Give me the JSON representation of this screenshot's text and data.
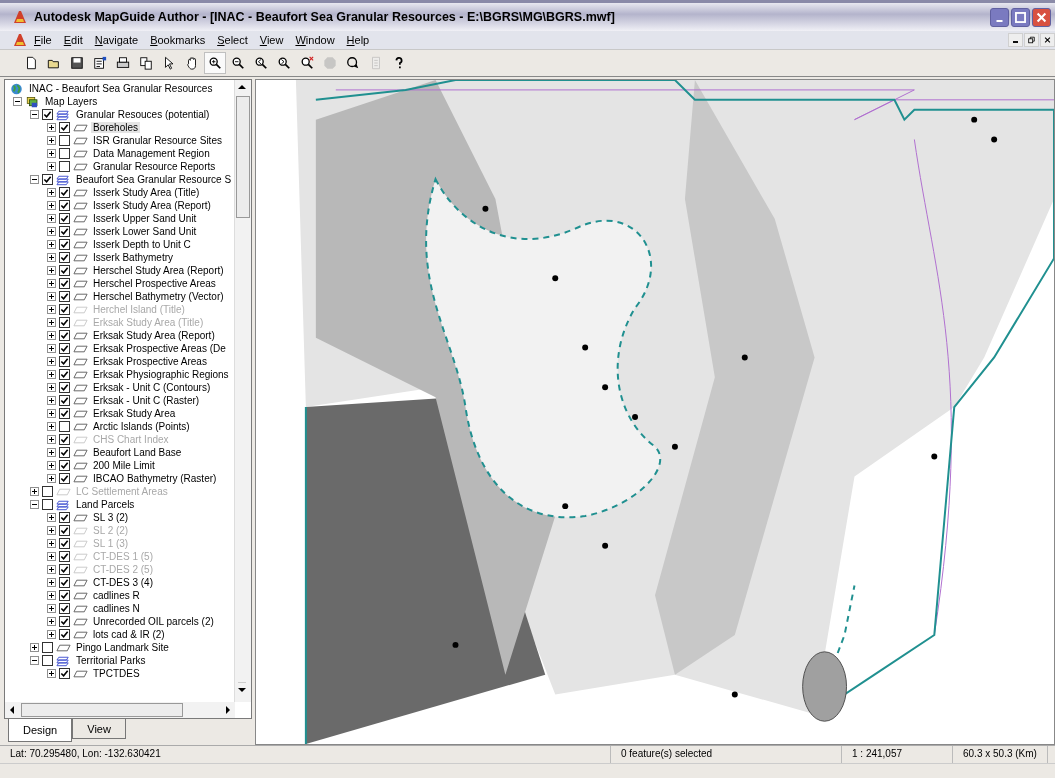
{
  "window": {
    "title": "Autodesk MapGuide Author - [INAC - Beaufort Sea Granular Resources - E:\\BGRS\\MG\\BGRS.mwf]"
  },
  "menu": [
    "File",
    "Edit",
    "Navigate",
    "Bookmarks",
    "Select",
    "View",
    "Window",
    "Help"
  ],
  "toolbar": [
    {
      "kind": "new",
      "selected": false,
      "disabled": false
    },
    {
      "kind": "open",
      "selected": false,
      "disabled": false
    },
    {
      "kind": "save",
      "selected": false,
      "disabled": false
    },
    {
      "kind": "properties",
      "selected": false,
      "disabled": false
    },
    {
      "kind": "print",
      "selected": false,
      "disabled": false
    },
    {
      "kind": "copy",
      "selected": false,
      "disabled": false
    },
    {
      "kind": "pointer",
      "selected": false,
      "disabled": false
    },
    {
      "kind": "hand",
      "selected": false,
      "disabled": false
    },
    {
      "kind": "zoomin",
      "selected": true,
      "disabled": false
    },
    {
      "kind": "zoomout",
      "selected": false,
      "disabled": false
    },
    {
      "kind": "zoomprev",
      "selected": false,
      "disabled": false
    },
    {
      "kind": "zoomnext",
      "selected": false,
      "disabled": false
    },
    {
      "kind": "zoomclear",
      "selected": false,
      "disabled": false
    },
    {
      "kind": "stop",
      "selected": false,
      "disabled": true
    },
    {
      "kind": "refresh",
      "selected": false,
      "disabled": false
    },
    {
      "kind": "page",
      "selected": false,
      "disabled": true
    },
    {
      "kind": "help",
      "selected": false,
      "disabled": false
    }
  ],
  "tree": {
    "label": "INAC - Beaufort Sea Granular Resources",
    "children": [
      {
        "label": "Map Layers",
        "kind": "maplayers",
        "expanded": true,
        "children": [
          {
            "label": "Granular Resouces (potential)",
            "kind": "group",
            "checked": true,
            "dimmed": false,
            "expanded": true,
            "selected": false,
            "children": [
              {
                "label": "Boreholes",
                "kind": "layer",
                "checked": true,
                "dimmed": false,
                "expanded": false,
                "selected": true
              },
              {
                "label": "ISR Granular Resource Sites",
                "kind": "layer",
                "checked": false,
                "dimmed": false,
                "expanded": false,
                "selected": false
              },
              {
                "label": "Data Management Region",
                "kind": "layer",
                "checked": false,
                "dimmed": false,
                "expanded": false,
                "selected": false
              },
              {
                "label": "Granular Resource Reports",
                "kind": "layer",
                "checked": false,
                "dimmed": false,
                "expanded": false,
                "selected": false
              }
            ]
          },
          {
            "label": "Beaufort Sea Granular Resource S",
            "kind": "group",
            "checked": true,
            "dimmed": false,
            "expanded": true,
            "selected": false,
            "children": [
              {
                "label": "Isserk Study Area (Title)",
                "kind": "layer",
                "checked": true,
                "dimmed": false,
                "expanded": false,
                "selected": false
              },
              {
                "label": "Isserk Study Area (Report)",
                "kind": "layer",
                "checked": true,
                "dimmed": false,
                "expanded": false,
                "selected": false
              },
              {
                "label": "Isserk Upper Sand Unit",
                "kind": "layer",
                "checked": true,
                "dimmed": false,
                "expanded": false,
                "selected": false
              },
              {
                "label": "Isserk Lower Sand Unit",
                "kind": "layer",
                "checked": true,
                "dimmed": false,
                "expanded": false,
                "selected": false
              },
              {
                "label": "Isserk Depth to Unit C",
                "kind": "layer",
                "checked": true,
                "dimmed": false,
                "expanded": false,
                "selected": false
              },
              {
                "label": "Isserk Bathymetry",
                "kind": "layer",
                "checked": true,
                "dimmed": false,
                "expanded": false,
                "selected": false
              },
              {
                "label": "Herschel Study Area (Report)",
                "kind": "layer",
                "checked": true,
                "dimmed": false,
                "expanded": false,
                "selected": false
              },
              {
                "label": "Herschel Prospective Areas",
                "kind": "layer",
                "checked": true,
                "dimmed": false,
                "expanded": false,
                "selected": false
              },
              {
                "label": "Herschel Bathymetry (Vector)",
                "kind": "layer",
                "checked": true,
                "dimmed": false,
                "expanded": false,
                "selected": false
              },
              {
                "label": "Herchel Island (Title)",
                "kind": "layer",
                "checked": true,
                "dimmed": true,
                "expanded": false,
                "selected": false
              },
              {
                "label": "Erksak Study Area (Title)",
                "kind": "layer",
                "checked": true,
                "dimmed": true,
                "expanded": false,
                "selected": false
              },
              {
                "label": "Erksak Study Area (Report)",
                "kind": "layer",
                "checked": true,
                "dimmed": false,
                "expanded": false,
                "selected": false
              },
              {
                "label": "Erksak Prospective Areas (De",
                "kind": "layer",
                "checked": true,
                "dimmed": false,
                "expanded": false,
                "selected": false
              },
              {
                "label": "Erksak Prospective Areas",
                "kind": "layer",
                "checked": true,
                "dimmed": false,
                "expanded": false,
                "selected": false
              },
              {
                "label": "Erksak Physiographic Regions",
                "kind": "layer",
                "checked": true,
                "dimmed": false,
                "expanded": false,
                "selected": false
              },
              {
                "label": "Erksak - Unit C (Contours)",
                "kind": "layer",
                "checked": true,
                "dimmed": false,
                "expanded": false,
                "selected": false
              },
              {
                "label": "Erksak - Unit C (Raster)",
                "kind": "layer",
                "checked": true,
                "dimmed": false,
                "expanded": false,
                "selected": false
              },
              {
                "label": "Erksak Study Area",
                "kind": "layer",
                "checked": true,
                "dimmed": false,
                "expanded": false,
                "selected": false
              },
              {
                "label": "Arctic Islands (Points)",
                "kind": "layer",
                "checked": false,
                "dimmed": false,
                "expanded": false,
                "selected": false
              },
              {
                "label": "CHS Chart Index",
                "kind": "layer",
                "checked": true,
                "dimmed": true,
                "expanded": false,
                "selected": false
              },
              {
                "label": "Beaufort Land Base",
                "kind": "layer",
                "checked": true,
                "dimmed": false,
                "expanded": false,
                "selected": false
              },
              {
                "label": "200 Mile Limit",
                "kind": "layer",
                "checked": true,
                "dimmed": false,
                "expanded": false,
                "selected": false
              },
              {
                "label": "IBCAO Bathymetry (Raster)",
                "kind": "layer",
                "checked": true,
                "dimmed": false,
                "expanded": false,
                "selected": false
              }
            ]
          },
          {
            "label": "LC Settlement Areas",
            "kind": "layer",
            "checked": false,
            "dimmed": true,
            "expanded": false,
            "selected": false
          },
          {
            "label": "Land Parcels",
            "kind": "group",
            "checked": false,
            "dimmed": false,
            "expanded": true,
            "selected": false,
            "children": [
              {
                "label": "SL 3 (2)",
                "kind": "layer",
                "checked": true,
                "dimmed": false,
                "expanded": false,
                "selected": false
              },
              {
                "label": "SL 2 (2)",
                "kind": "layer",
                "checked": true,
                "dimmed": true,
                "expanded": false,
                "selected": false
              },
              {
                "label": "SL 1 (3)",
                "kind": "layer",
                "checked": true,
                "dimmed": true,
                "expanded": false,
                "selected": false
              },
              {
                "label": "CT-DES 1 (5)",
                "kind": "layer",
                "checked": true,
                "dimmed": true,
                "expanded": false,
                "selected": false
              },
              {
                "label": "CT-DES 2 (5)",
                "kind": "layer",
                "checked": true,
                "dimmed": true,
                "expanded": false,
                "selected": false
              },
              {
                "label": "CT-DES 3 (4)",
                "kind": "layer",
                "checked": true,
                "dimmed": false,
                "expanded": false,
                "selected": false
              },
              {
                "label": "cadlines R",
                "kind": "layer",
                "checked": true,
                "dimmed": false,
                "expanded": false,
                "selected": false
              },
              {
                "label": "cadlines N",
                "kind": "layer",
                "checked": true,
                "dimmed": false,
                "expanded": false,
                "selected": false
              },
              {
                "label": "Unrecorded OIL parcels (2)",
                "kind": "layer",
                "checked": true,
                "dimmed": false,
                "expanded": false,
                "selected": false
              },
              {
                "label": "lots cad & IR (2)",
                "kind": "layer",
                "checked": true,
                "dimmed": false,
                "expanded": false,
                "selected": false
              }
            ]
          },
          {
            "label": "Pingo Landmark Site",
            "kind": "layer",
            "checked": false,
            "dimmed": false,
            "expanded": false,
            "selected": false
          },
          {
            "label": "Territorial Parks",
            "kind": "group",
            "checked": false,
            "dimmed": false,
            "expanded": true,
            "selected": false,
            "children": [
              {
                "label": "TPCTDES",
                "kind": "layer",
                "checked": true,
                "dimmed": false,
                "expanded": false,
                "selected": false
              }
            ]
          }
        ]
      }
    ]
  },
  "tabs": [
    {
      "label": "Design",
      "selected": true
    },
    {
      "label": "View",
      "selected": false
    }
  ],
  "status_bar": [
    "Lat: 70.295480, Lon: -132.630421",
    "0 feature(s) selected",
    "1 : 241,057",
    "60.3 x 50.3 (Km)"
  ]
}
